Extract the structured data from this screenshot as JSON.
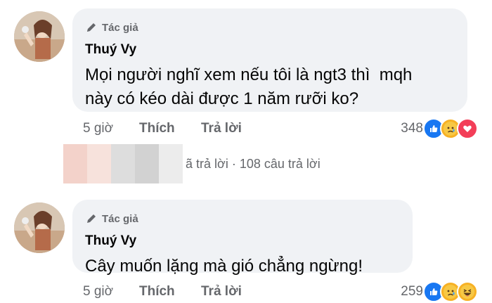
{
  "comments": [
    {
      "badge": "Tác giả",
      "name": "Thuý Vy",
      "text": "Mọi người nghĩ xem nếu tôi là ngt3 thì  mqh\nnày có kéo dài được 1 năm rưỡi ko?",
      "time": "5 giờ",
      "like": "Thích",
      "reply": "Trả lời",
      "reaction_count": "348",
      "reactions": [
        "like-icon",
        "sad-icon",
        "love-icon"
      ]
    },
    {
      "badge": "Tác giả",
      "name": "Thuý Vy",
      "text": "Cây muốn lặng mà gió chẳng ngừng!",
      "time": "5 giờ",
      "like": "Thích",
      "reply": "Trả lời",
      "reaction_count": "259",
      "reactions": [
        "like-icon",
        "sad-icon",
        "haha-icon"
      ]
    }
  ],
  "replies_summary": {
    "replied": "ã trả lời",
    "separator": "·",
    "count_text": "108 câu trả lời"
  },
  "colors": {
    "bubble": "#f0f2f5",
    "muted": "#65676b",
    "like": "#1877f2",
    "love": "#f33e58",
    "sad": "#f7b125"
  }
}
